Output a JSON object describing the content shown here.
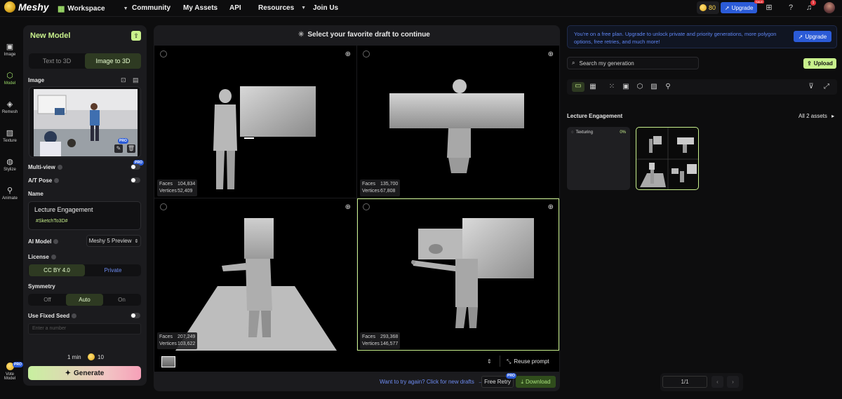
{
  "brand": {
    "name": "Meshy"
  },
  "nav": {
    "workspace": "Workspace",
    "community": "Community",
    "my_assets": "My Assets",
    "api": "API",
    "resources": "Resources",
    "join_us": "Join Us"
  },
  "topbar": {
    "credits": "80",
    "upgrade": "Upgrade",
    "sale_badge": "SALE",
    "notifications": "1"
  },
  "rail": [
    "Image",
    "Model",
    "Remesh",
    "Texture",
    "Stylize",
    "Animate"
  ],
  "rail_bottom": {
    "pro": "PRO",
    "label1": "Vote",
    "label2": "Model"
  },
  "panel": {
    "title": "New Model",
    "tabs": [
      "Text to 3D",
      "Image to 3D"
    ],
    "image_label": "Image",
    "multiview": "Multi-view",
    "at_pose": "A/T Pose",
    "name_label": "Name",
    "name_value": "Lecture Engagement",
    "tag": "#SketchTo3D#",
    "ai_model_label": "AI Model",
    "ai_model_value": "Meshy 5 Preview",
    "license_label": "License",
    "license_opts": [
      "CC BY 4.0",
      "Private"
    ],
    "symmetry_label": "Symmetry",
    "symmetry_opts": [
      "Off",
      "Auto",
      "On"
    ],
    "seed_label": "Use Fixed Seed",
    "seed_placeholder": "Enter a number",
    "time": "1 min",
    "cost": "10",
    "generate": "Generate",
    "pro": "PRO"
  },
  "center": {
    "header": "Select your favorite draft to continue",
    "drafts": [
      {
        "faces": "104,834",
        "vertices": "52,409"
      },
      {
        "faces": "135,700",
        "vertices": "67,808"
      },
      {
        "faces": "207,249",
        "vertices": "103,622"
      },
      {
        "faces": "293,368",
        "vertices": "146,577"
      }
    ],
    "faces_label": "Faces",
    "vertices_label": "Vertices",
    "reuse": "Reuse prompt",
    "retry_link": "Want to try again? Click for new drafts",
    "free_retry": "Free Retry",
    "download": "Download"
  },
  "right": {
    "promo": "You're on a free plan. Upgrade to unlock private and priority generations, more polygon options, free retries, and much more!",
    "promo_btn": "Upgrade",
    "search_placeholder": "Search my generation",
    "upload": "Upload",
    "section_title": "Lecture Engagement",
    "all_assets": "All 2 assets",
    "texturing": "Texturing",
    "texturing_pct": "0%",
    "page": "1/1"
  }
}
